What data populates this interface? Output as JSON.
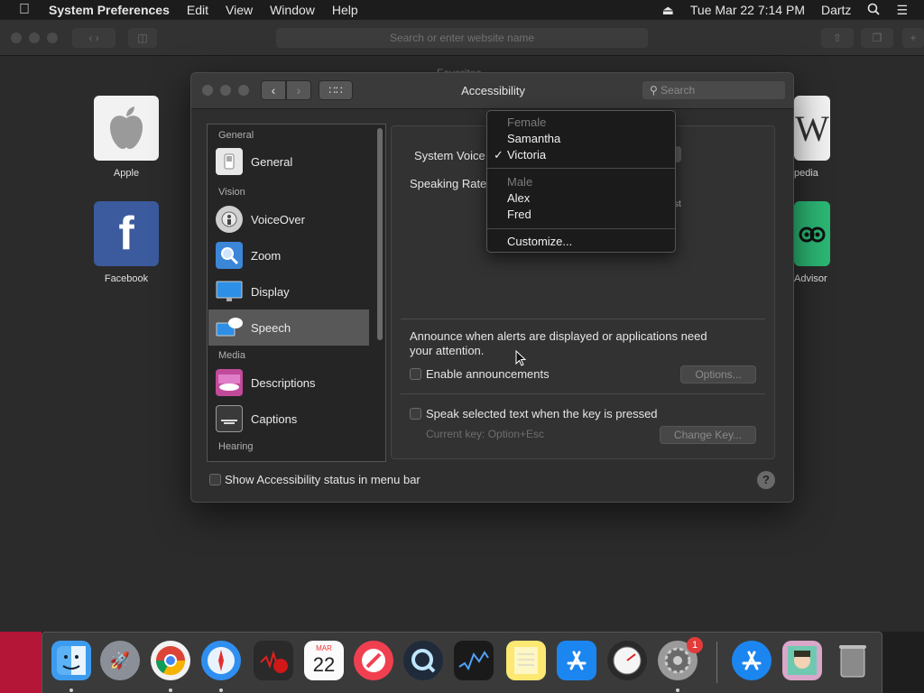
{
  "menubar": {
    "apple_icon": "apple-logo",
    "app_name": "System Preferences",
    "items": [
      "Edit",
      "View",
      "Window",
      "Help"
    ],
    "datetime": "Tue Mar 22  7:14 PM",
    "user": "Dartz"
  },
  "safari": {
    "url_placeholder": "Search or enter website name",
    "favorites_title": "Favorites",
    "favorites": [
      {
        "label": "Apple"
      },
      {
        "label": "Facebook"
      },
      {
        "label": "pedia"
      },
      {
        "label": "Advisor"
      }
    ]
  },
  "prefs": {
    "title": "Accessibility",
    "search_placeholder": "Search",
    "sidebar": {
      "headers": [
        "General",
        "Vision",
        "Media",
        "Hearing"
      ],
      "items": [
        {
          "label": "General",
          "icon": "switch-icon"
        },
        {
          "label": "VoiceOver",
          "icon": "voiceover-icon"
        },
        {
          "label": "Zoom",
          "icon": "zoom-icon"
        },
        {
          "label": "Display",
          "icon": "display-icon"
        },
        {
          "label": "Speech",
          "icon": "speech-icon",
          "selected": true
        },
        {
          "label": "Descriptions",
          "icon": "descriptions-icon"
        },
        {
          "label": "Captions",
          "icon": "captions-icon"
        }
      ]
    },
    "panel": {
      "system_voice_label": "System Voice",
      "speaking_rate_label": "Speaking Rate",
      "rate_fast_fragment": "st",
      "announce_text_1": "Announce when alerts are displayed or applications need",
      "announce_text_2": "your attention.",
      "enable_announcements": "Enable announcements",
      "options_button": "Options...",
      "speak_selected": "Speak selected text when the key is pressed",
      "current_key": "Current key: Option+Esc",
      "change_key_button": "Change Key..."
    },
    "show_status": "Show Accessibility status in menu bar",
    "help": "?"
  },
  "dropdown": {
    "female_header": "Female",
    "female": [
      "Samantha",
      "Victoria"
    ],
    "selected": "Victoria",
    "male_header": "Male",
    "male": [
      "Alex",
      "Fred"
    ],
    "customize": "Customize..."
  },
  "dock": {
    "calendar_month": "MAR",
    "calendar_day": "22",
    "badge": "1"
  }
}
